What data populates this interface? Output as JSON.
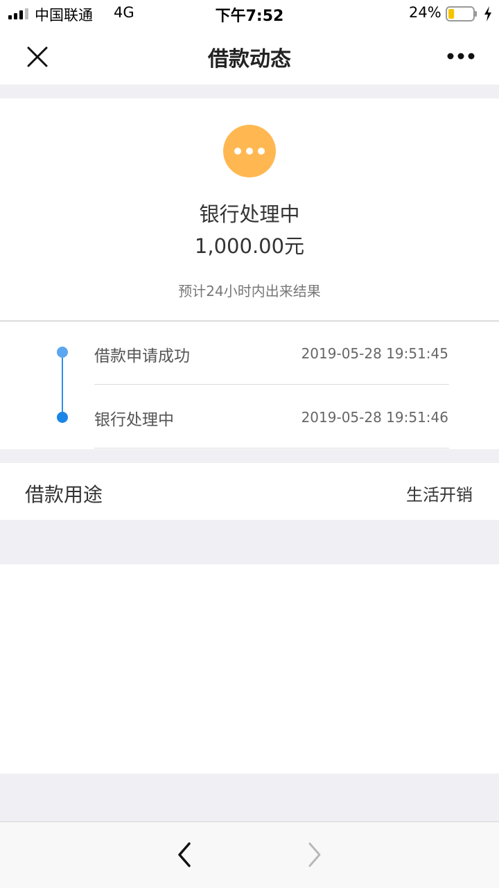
{
  "status_bar": {
    "carrier": "中国联通",
    "network": "4G",
    "time": "下午7:52",
    "battery_percent": "24%",
    "battery_level": 0.24,
    "icons": [
      "signal-icon",
      "battery-icon",
      "charging-icon"
    ]
  },
  "nav": {
    "title": "借款动态",
    "icons": [
      "close-icon",
      "more-icon"
    ]
  },
  "status_card": {
    "title": "银行处理中",
    "amount": "1,000.00元",
    "note": "预计24小时内出来结果",
    "icon": "pending-dots-icon",
    "icon_color": "#ffb851"
  },
  "timeline": [
    {
      "label": "借款申请成功",
      "time": "2019-05-28 19:51:45",
      "dot_color": "#5ba6f0"
    },
    {
      "label": "银行处理中",
      "time": "2019-05-28 19:51:46",
      "dot_color": "#1a86e6"
    }
  ],
  "purpose": {
    "label": "借款用途",
    "value": "生活开销"
  },
  "toolbar": {
    "icons": [
      "back-icon",
      "forward-icon"
    ]
  },
  "colors": {
    "accent": "#2f8ee8",
    "pending": "#ffb851",
    "separator_bg": "#efeff4"
  }
}
